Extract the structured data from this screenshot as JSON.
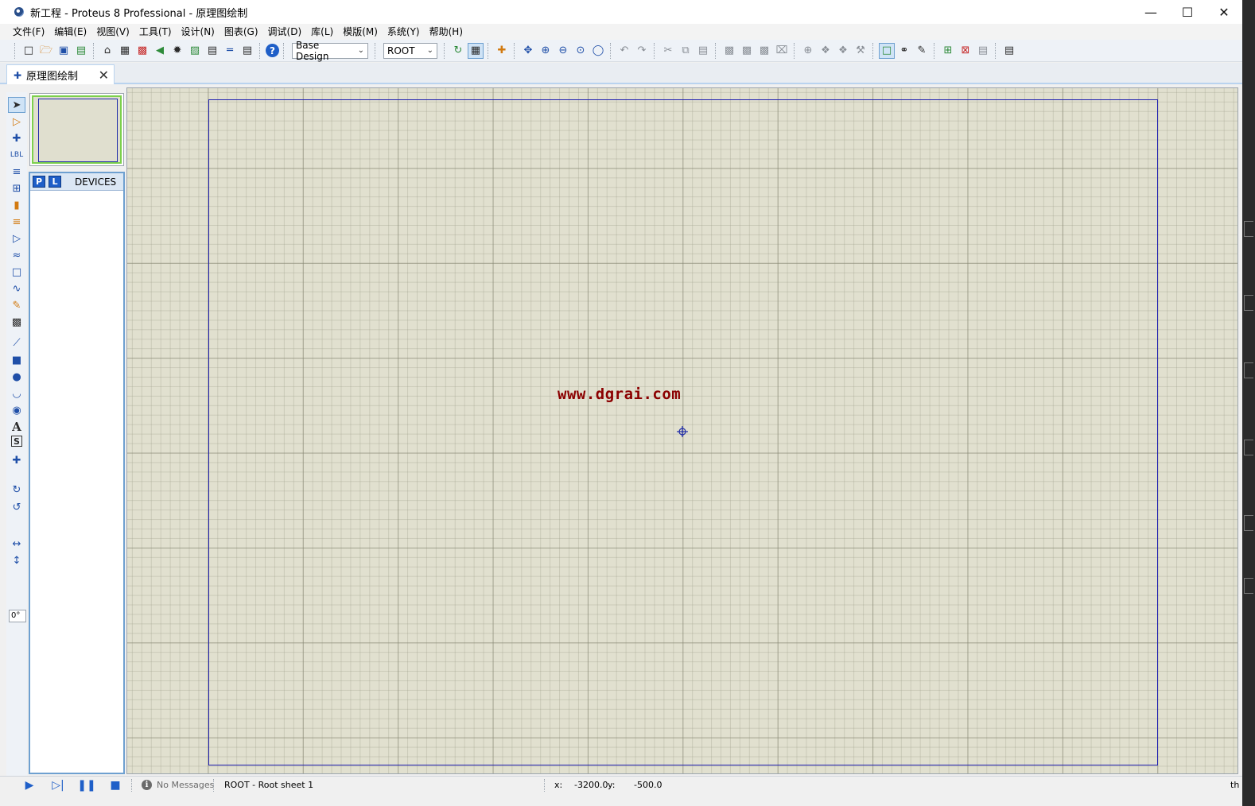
{
  "window": {
    "title": "新工程 - Proteus 8 Professional - 原理图绘制",
    "minimize": "—",
    "maximize": "☐",
    "close": "✕"
  },
  "menu": [
    "文件(F)",
    "编辑(E)",
    "视图(V)",
    "工具(T)",
    "设计(N)",
    "图表(G)",
    "调试(D)",
    "库(L)",
    "模版(M)",
    "系统(Y)",
    "帮助(H)"
  ],
  "toolbar": {
    "design_select": "Base Design",
    "sheet_select": "ROOT",
    "help_glyph": "?"
  },
  "tab": {
    "label": "原理图绘制",
    "close": "✕"
  },
  "leftpanel": {
    "angle_value": "0°",
    "text_tool_glyph": "A",
    "label_tool_glyph": "LBL",
    "symbol_tool_glyph": "S"
  },
  "devices": {
    "p_button": "P",
    "l_button": "L",
    "title": "DEVICES"
  },
  "canvas": {
    "watermark": "www.dgrai.com"
  },
  "status": {
    "messages": "No Messages",
    "sheet": "ROOT - Root sheet 1",
    "x_label": "x:",
    "x_value": "-3200.0",
    "y_label": "y:",
    "y_value": "-500.0",
    "units": "th"
  },
  "colors": {
    "canvas_bg": "#e1e0cf",
    "sheet_border": "#2020b0",
    "watermark": "#8b0000",
    "accent": "#1f5fc8"
  }
}
